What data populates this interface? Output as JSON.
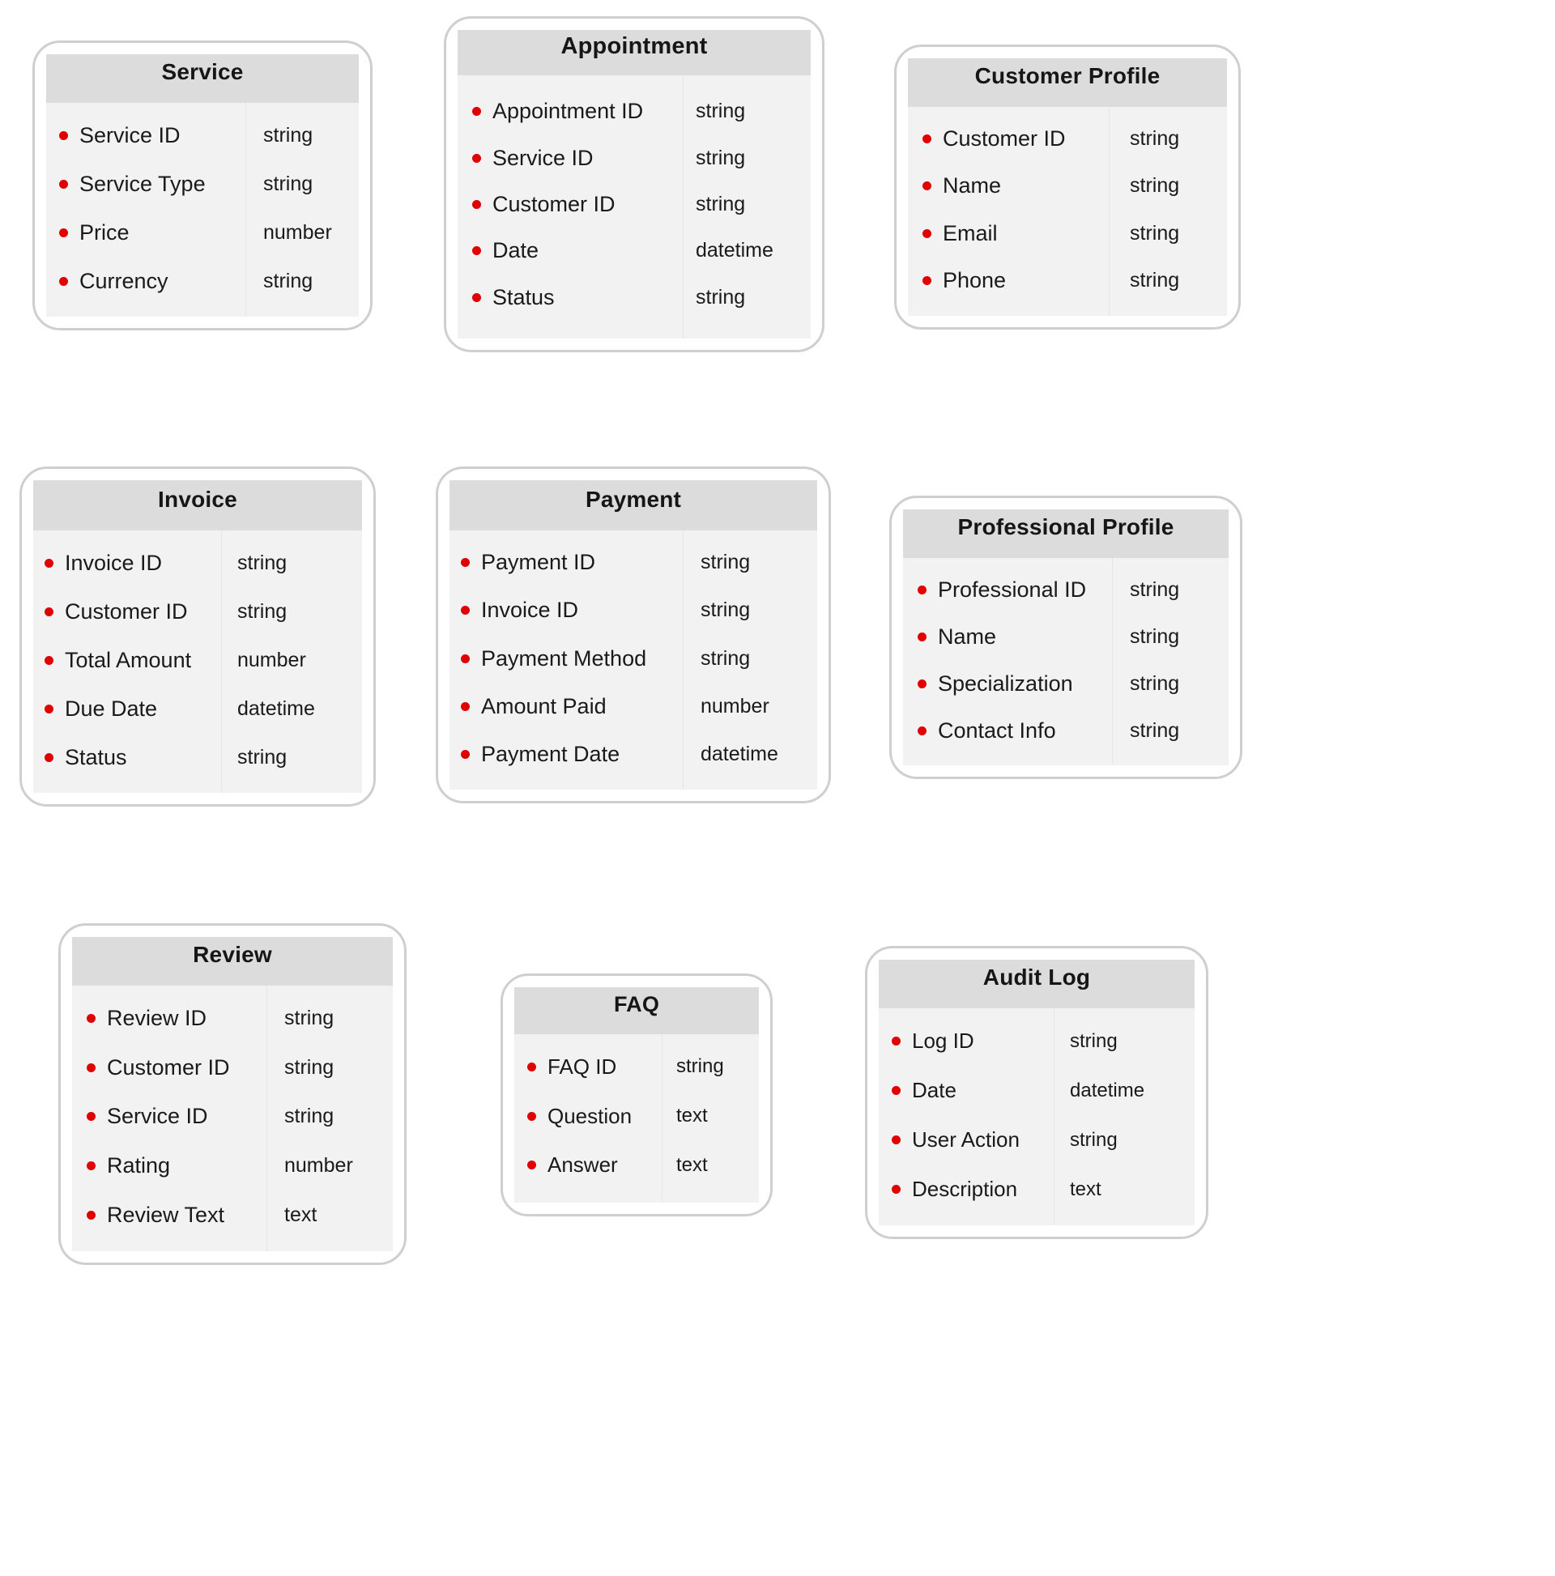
{
  "diagram": {
    "type": "entity-schema",
    "background_color": "#ffffff",
    "card_border_color": "#cfcfcf",
    "header_background_color": "#dcdcdc",
    "body_background_color": "#f2f2f2",
    "bullet_color": "#e00000",
    "text_color": "#1a1a1a",
    "entities": [
      {
        "id": "service",
        "title": "Service",
        "fields": [
          {
            "name": "Service ID",
            "type": "string"
          },
          {
            "name": "Service Type",
            "type": "string"
          },
          {
            "name": "Price",
            "type": "number"
          },
          {
            "name": "Currency",
            "type": "string"
          }
        ]
      },
      {
        "id": "appointment",
        "title": "Appointment",
        "fields": [
          {
            "name": "Appointment ID",
            "type": "string"
          },
          {
            "name": "Service ID",
            "type": "string"
          },
          {
            "name": "Customer ID",
            "type": "string"
          },
          {
            "name": "Date",
            "type": "datetime"
          },
          {
            "name": "Status",
            "type": "string"
          }
        ]
      },
      {
        "id": "customer-profile",
        "title": "Customer Profile",
        "fields": [
          {
            "name": "Customer ID",
            "type": "string"
          },
          {
            "name": "Name",
            "type": "string"
          },
          {
            "name": "Email",
            "type": "string"
          },
          {
            "name": "Phone",
            "type": "string"
          }
        ]
      },
      {
        "id": "invoice",
        "title": "Invoice",
        "fields": [
          {
            "name": "Invoice ID",
            "type": "string"
          },
          {
            "name": "Customer ID",
            "type": "string"
          },
          {
            "name": "Total Amount",
            "type": "number"
          },
          {
            "name": "Due Date",
            "type": "datetime"
          },
          {
            "name": "Status",
            "type": "string"
          }
        ]
      },
      {
        "id": "payment",
        "title": "Payment",
        "fields": [
          {
            "name": "Payment ID",
            "type": "string"
          },
          {
            "name": "Invoice ID",
            "type": "string"
          },
          {
            "name": "Payment Method",
            "type": "string"
          },
          {
            "name": "Amount Paid",
            "type": "number"
          },
          {
            "name": "Payment Date",
            "type": "datetime"
          }
        ]
      },
      {
        "id": "professional-profile",
        "title": "Professional Profile",
        "fields": [
          {
            "name": "Professional ID",
            "type": "string"
          },
          {
            "name": "Name",
            "type": "string"
          },
          {
            "name": "Specialization",
            "type": "string"
          },
          {
            "name": "Contact Info",
            "type": "string"
          }
        ]
      },
      {
        "id": "review",
        "title": "Review",
        "fields": [
          {
            "name": "Review ID",
            "type": "string"
          },
          {
            "name": "Customer ID",
            "type": "string"
          },
          {
            "name": "Service ID",
            "type": "string"
          },
          {
            "name": "Rating",
            "type": "number"
          },
          {
            "name": "Review Text",
            "type": "text"
          }
        ]
      },
      {
        "id": "faq",
        "title": "FAQ",
        "fields": [
          {
            "name": "FAQ ID",
            "type": "string"
          },
          {
            "name": "Question",
            "type": "text"
          },
          {
            "name": "Answer",
            "type": "text"
          }
        ]
      },
      {
        "id": "audit-log",
        "title": "Audit Log",
        "fields": [
          {
            "name": "Log ID",
            "type": "string"
          },
          {
            "name": "Date",
            "type": "datetime"
          },
          {
            "name": "User Action",
            "type": "string"
          },
          {
            "name": "Description",
            "type": "text"
          }
        ]
      }
    ]
  }
}
